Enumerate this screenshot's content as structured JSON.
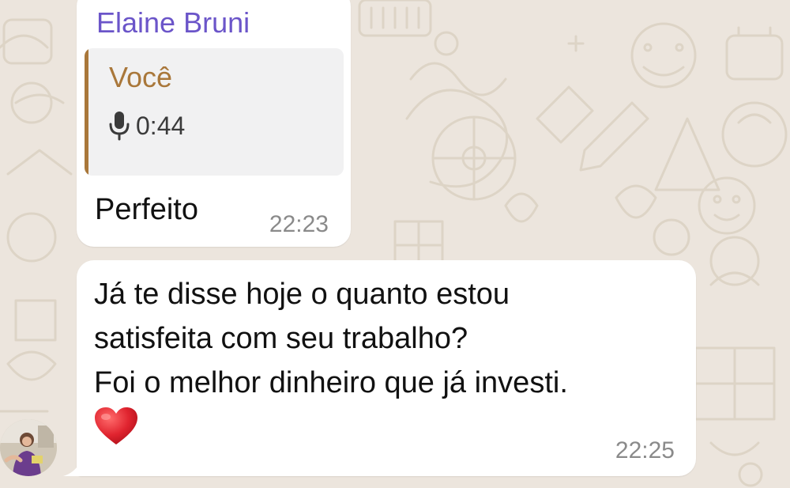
{
  "chat": {
    "messages": [
      {
        "sender": "Elaine Bruni",
        "reply_to": {
          "author": "Você",
          "audio_duration": "0:44"
        },
        "text": "Perfeito",
        "time": "22:23"
      },
      {
        "lines": [
          "Já te disse hoje o quanto estou",
          "satisfeita com seu trabalho?",
          "Foi o melhor dinheiro que já investi."
        ],
        "emoji": "heart-emoji",
        "time": "22:25"
      }
    ]
  },
  "colors": {
    "background": "#ece5dd",
    "bubble": "#ffffff",
    "sender_name": "#6b55c9",
    "quote_accent": "#a9773a",
    "timestamp": "#8a8a8a",
    "heart": "#e0242f"
  },
  "icons": [
    "microphone-icon",
    "heart-emoji",
    "avatar"
  ]
}
